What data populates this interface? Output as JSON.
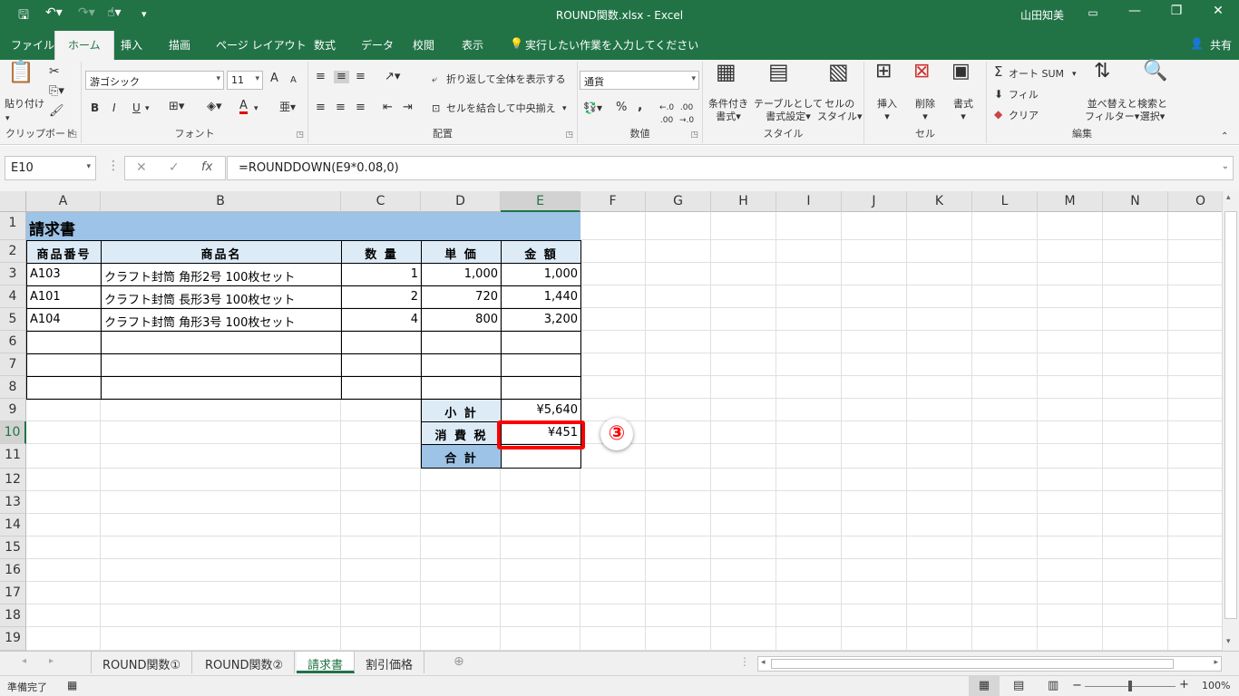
{
  "window": {
    "title": "ROUND関数.xlsx  -  Excel",
    "user": "山田知美"
  },
  "quick_access": {
    "save": "save-icon",
    "undo": "undo-icon",
    "redo": "redo-icon",
    "touch": "touch-mode-icon"
  },
  "ribbon_tabs": [
    "ファイル",
    "ホーム",
    "挿入",
    "描画",
    "ページ レイアウト",
    "数式",
    "データ",
    "校閲",
    "表示"
  ],
  "active_tab": "ホーム",
  "tell_me": "実行したい作業を入力してください",
  "share": "共有",
  "groups": {
    "clipboard": {
      "label": "クリップボード",
      "paste": "貼り付け"
    },
    "font": {
      "label": "フォント",
      "font_name": "游ゴシック",
      "font_size": "11",
      "bold": "B",
      "italic": "I",
      "underline": "U",
      "increase": "A",
      "decrease": "A",
      "font_color": "A"
    },
    "alignment": {
      "label": "配置",
      "wrap": "折り返して全体を表示する",
      "merge": "セルを結合して中央揃え"
    },
    "number": {
      "label": "数値",
      "format": "通貨",
      "percent": "%",
      "comma": ","
    },
    "styles": {
      "label": "スタイル",
      "cond": "条件付き",
      "cond2": "書式",
      "table": "テーブルとして",
      "table2": "書式設定",
      "cell": "セルの",
      "cell2": "スタイル"
    },
    "cells": {
      "label": "セル",
      "insert": "挿入",
      "delete": "削除",
      "format": "書式"
    },
    "editing": {
      "label": "編集",
      "autosum": "オート SUM",
      "fill": "フィル",
      "clear": "クリア",
      "sort": "並べ替えと",
      "sort2": "フィルター",
      "find": "検索と",
      "find2": "選択"
    }
  },
  "formula_bar": {
    "name_box": "E10",
    "formula": "=ROUNDDOWN(E9*0.08,0)",
    "fx": "fx"
  },
  "columns": [
    "A",
    "B",
    "C",
    "D",
    "E",
    "F",
    "G",
    "H",
    "I",
    "J",
    "K",
    "L",
    "M",
    "N",
    "O"
  ],
  "rows": [
    "1",
    "2",
    "3",
    "4",
    "5",
    "6",
    "7",
    "8",
    "9",
    "10",
    "11",
    "12",
    "13",
    "14",
    "15",
    "16",
    "17",
    "18",
    "19"
  ],
  "sheet": {
    "title": "請求書",
    "headers": [
      "商品番号",
      "商品名",
      "数 量",
      "単 価",
      "金 額"
    ],
    "items": [
      {
        "code": "A103",
        "name": "クラフト封筒 角形2号 100枚セット",
        "qty": "1",
        "price": "1,000",
        "amount": "1,000"
      },
      {
        "code": "A101",
        "name": "クラフト封筒 長形3号 100枚セット",
        "qty": "2",
        "price": "720",
        "amount": "1,440"
      },
      {
        "code": "A104",
        "name": "クラフト封筒 角形3号 100枚セット",
        "qty": "4",
        "price": "800",
        "amount": "3,200"
      }
    ],
    "subtotal_label": "小 計",
    "subtotal": "¥5,640",
    "tax_label": "消 費 税",
    "tax": "¥451",
    "total_label": "合 計",
    "total": ""
  },
  "annotation": "③",
  "sheet_tabs": [
    "ROUND関数①",
    "ROUND関数②",
    "請求書",
    "割引価格"
  ],
  "active_sheet": "請求書",
  "status": {
    "mode": "準備完了",
    "zoom": "100%"
  }
}
